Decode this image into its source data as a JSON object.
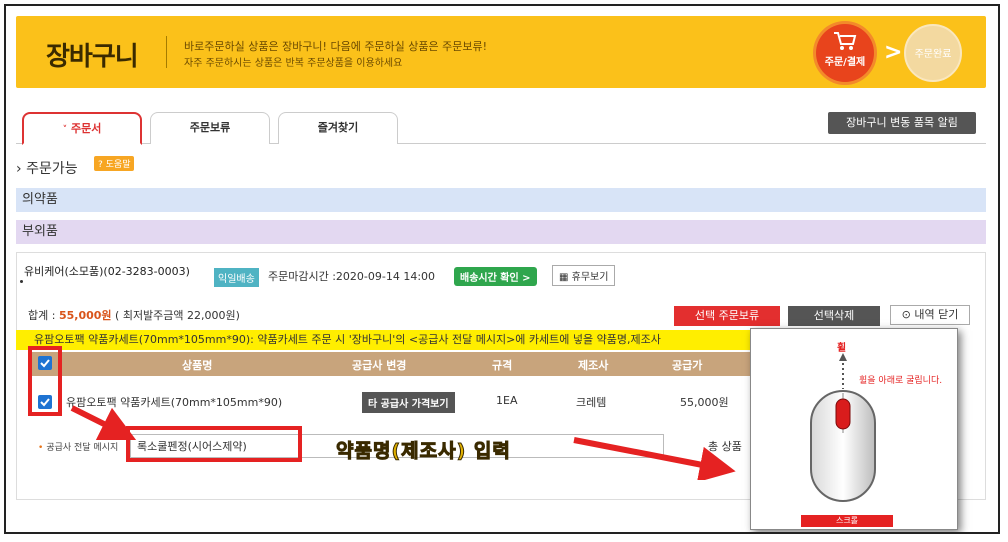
{
  "header": {
    "title": "장바구니",
    "desc_line1": "바로주문하실 상품은 장바구니! 다음에 주문하실 상품은 주문보류!",
    "desc_line2": "자주 주문하시는 상품은 반복 주문상품을 이용하세요",
    "step_active": "주문/결제",
    "step_done": "주문완료",
    "step_arrow": ">"
  },
  "tabs": [
    {
      "label": "주문서"
    },
    {
      "label": "주문보류"
    },
    {
      "label": "즐겨찾기"
    }
  ],
  "notice_button": "장바구니 변동 품목 알림",
  "section": {
    "title": "주문가능",
    "help": "? 도움말"
  },
  "categories": [
    "의약품",
    "부외품"
  ],
  "supplier": {
    "name": "유비케어(소모품)(02-3283-0003)",
    "delivery_badge": "익일배송",
    "deadline": "주문마감시간 :2020-09-14 14:00",
    "ship_button": "배송시간 확인 >",
    "holiday_button": "휴무보기",
    "total_label": "합계 : ",
    "total_amount": "55,000원",
    "min_order": "( 최저발주금액 22,000원)"
  },
  "actions": {
    "hold": "선택 주문보류",
    "delete": "선택삭제",
    "fold": "내역 닫기"
  },
  "notice_text": "유팜오토팩 약품카세트(70mm*105mm*90): 약품카세트 주문 시 '장바구니'의 <공급사 전달 메시지>에 카세트에 넣을 약품명,제조사",
  "table": {
    "headers": [
      "상품명",
      "공급사 변경",
      "규격",
      "제조사",
      "공급가"
    ],
    "row": {
      "name": "유팜오토팩 약품카세트(70mm*105mm*90)",
      "compare": "타 공급사 가격보기",
      "spec": "1EA",
      "maker": "크레템",
      "price": "55,000원"
    }
  },
  "message": {
    "label": "공급사 전달 메시지",
    "value": "록소쿨펜정(시어스제약)"
  },
  "total_products": "총 상품",
  "annotation": "약품명(제조사) 입력",
  "popup": {
    "wheel": "휠",
    "hint": "휠을 아래로 굴립니다.",
    "scroll": "스크롤"
  }
}
